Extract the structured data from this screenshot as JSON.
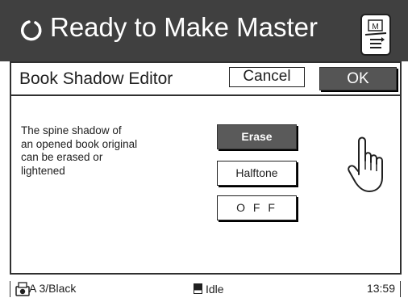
{
  "header": {
    "title": "Ready to Make Master",
    "status_icon": "refresh-icon",
    "right_icon": "master-icon",
    "right_icon_letter": "M",
    "background": "#404040"
  },
  "dialog": {
    "title": "Book Shadow Editor",
    "cancel_label": "Cancel",
    "ok_label": "OK",
    "description": "The spine shadow of\nan opened book original\ncan be erased or\nlightened",
    "options": [
      {
        "label": "Erase",
        "selected": true
      },
      {
        "label": "Halftone",
        "selected": false
      },
      {
        "label": "O F F",
        "selected": false
      }
    ]
  },
  "status_bar": {
    "paper": "A 3/Black",
    "state": "Idle",
    "time": "13:59"
  },
  "colors": {
    "selected_button": "#5a5a5a",
    "ok_button": "#555555"
  }
}
